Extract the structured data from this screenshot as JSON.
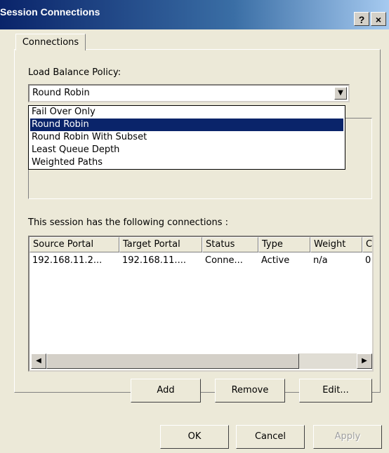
{
  "window": {
    "title": "Session Connections",
    "help_label": "?",
    "close_label": "×"
  },
  "tabs": [
    {
      "label": "Connections"
    }
  ],
  "policy": {
    "label": "Load Balance Policy:",
    "selected": "Round Robin",
    "options": [
      "Fail Over Only",
      "Round Robin",
      "Round Robin With Subset",
      "Least Queue Depth",
      "Weighted Paths"
    ],
    "highlighted_index": 1
  },
  "connections": {
    "label": "This session has the following connections :",
    "columns": [
      "Source Portal",
      "Target Portal",
      "Status",
      "Type",
      "Weight",
      "C"
    ],
    "rows": [
      [
        "192.168.11.2...",
        "192.168.11....",
        "Conne...",
        "Active",
        "n/a",
        "0"
      ]
    ]
  },
  "actions": {
    "add": "Add",
    "remove": "Remove",
    "edit": "Edit..."
  },
  "footer": {
    "ok": "OK",
    "cancel": "Cancel",
    "apply": "Apply"
  }
}
